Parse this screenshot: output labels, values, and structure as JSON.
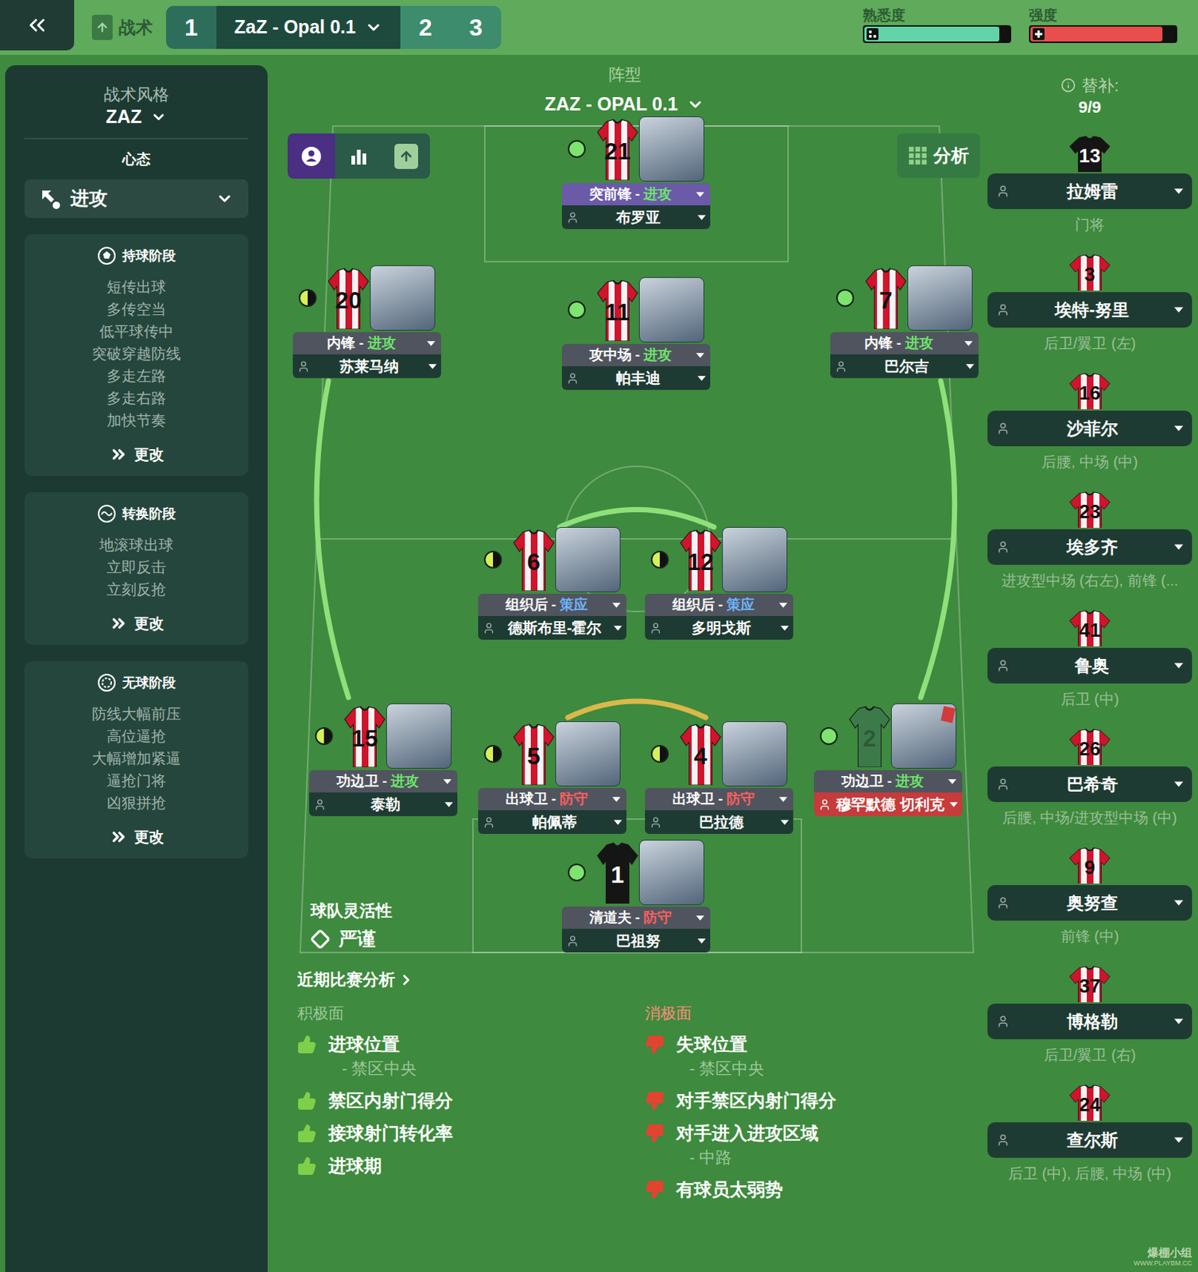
{
  "top_bar": {
    "tactics_tab": "战术",
    "tactic_slots": [
      {
        "label": "1",
        "selected": true,
        "name": "ZaZ - Opal 0.1"
      },
      {
        "label": "2",
        "selected": false,
        "name": ""
      },
      {
        "label": "3",
        "selected": false,
        "name": ""
      }
    ],
    "meters": [
      {
        "label": "熟悉度",
        "level": 0.93,
        "kind": "familiarity",
        "color": "#62d4a8"
      },
      {
        "label": "强度",
        "level": 0.91,
        "kind": "intensity",
        "color": "#e84e4c"
      }
    ]
  },
  "sidebar": {
    "style_label": "战术风格",
    "style_value": "ZAZ",
    "mentality_label": "心态",
    "mentality_value": "进攻",
    "change_label": "更改",
    "phases": [
      {
        "title": "持球阶段",
        "kind": "possession",
        "instructions": [
          "短传出球",
          "多传空当",
          "低平球传中",
          "突破穿越防线",
          "多走左路",
          "多走右路",
          "加快节奏"
        ]
      },
      {
        "title": "转换阶段",
        "kind": "transition",
        "instructions": [
          "地滚球出球",
          "立即反击",
          "立刻反抢"
        ]
      },
      {
        "title": "无球阶段",
        "kind": "defence",
        "instructions": [
          "防线大幅前压",
          "高位逼抢",
          "大幅增加紧逼",
          "逼抢门将",
          "凶狠拼抢"
        ]
      }
    ]
  },
  "pitch": {
    "formation_label": "阵型",
    "formation_name": "ZAZ - OPAL 0.1",
    "analysis_button": "分析",
    "view_buttons": [
      {
        "kind": "profile",
        "selected": true
      },
      {
        "kind": "stats",
        "selected": false
      },
      {
        "kind": "instructions",
        "selected": false
      }
    ],
    "role_separator": " - ",
    "flexibility_label": "球队灵活性",
    "flexibility_value": "严谨",
    "players": [
      {
        "number": "21",
        "role": "突前锋",
        "duty": "进攻",
        "duty_color": "#6de46a",
        "name": "布罗亚",
        "condition_level": 1,
        "shirt": "home",
        "selected": true,
        "warning": false
      },
      {
        "number": "20",
        "role": "内锋",
        "duty": "进攻",
        "duty_color": "#6de46a",
        "name": "苏莱马纳",
        "condition_level": 0.5,
        "shirt": "home",
        "selected": false,
        "warning": false
      },
      {
        "number": "11",
        "role": "攻中场",
        "duty": "进攻",
        "duty_color": "#6de46a",
        "name": "帕丰迪",
        "condition_level": 1,
        "shirt": "home",
        "selected": false,
        "warning": false
      },
      {
        "number": "7",
        "role": "内锋",
        "duty": "进攻",
        "duty_color": "#6de46a",
        "name": "巴尔吉",
        "condition_level": 1,
        "shirt": "home",
        "selected": false,
        "warning": false
      },
      {
        "number": "6",
        "role": "组织后",
        "duty": "策应",
        "duty_color": "#6cb6ff",
        "name": "德斯布里-霍尔",
        "condition_level": 0.5,
        "shirt": "home",
        "selected": false,
        "warning": false
      },
      {
        "number": "12",
        "role": "组织后",
        "duty": "策应",
        "duty_color": "#6cb6ff",
        "name": "多明戈斯",
        "condition_level": 0.5,
        "shirt": "home",
        "selected": false,
        "warning": false
      },
      {
        "number": "15",
        "role": "功边卫",
        "duty": "进攻",
        "duty_color": "#6de46a",
        "name": "泰勒",
        "condition_level": 0.5,
        "shirt": "home",
        "selected": false,
        "warning": false
      },
      {
        "number": "5",
        "role": "出球卫",
        "duty": "防守",
        "duty_color": "#ff5f5f",
        "name": "帕佩蒂",
        "condition_level": 0.5,
        "shirt": "home",
        "selected": false,
        "warning": false
      },
      {
        "number": "4",
        "role": "出球卫",
        "duty": "防守",
        "duty_color": "#ff5f5f",
        "name": "巴拉德",
        "condition_level": 0.5,
        "shirt": "home",
        "selected": false,
        "warning": false
      },
      {
        "number": "2",
        "role": "功边卫",
        "duty": "进攻",
        "duty_color": "#6de46a",
        "name": "穆罕默德 切利克",
        "condition_level": 1,
        "shirt": "faded",
        "selected": false,
        "warning": true
      },
      {
        "number": "1",
        "role": "清道夫",
        "duty": "防守",
        "duty_color": "#ff5f5f",
        "name": "巴祖努",
        "condition_level": 1,
        "shirt": "keeper",
        "selected": false,
        "warning": false
      }
    ]
  },
  "subs": {
    "label": "替补:",
    "count": "9/9",
    "players": [
      {
        "number": "13",
        "name": "拉姆雷",
        "position": "门将",
        "shirt": "keeper"
      },
      {
        "number": "3",
        "name": "埃特-努里",
        "position": "后卫/翼卫 (左)",
        "shirt": "home"
      },
      {
        "number": "16",
        "name": "沙菲尔",
        "position": "后腰, 中场 (中)",
        "shirt": "home"
      },
      {
        "number": "23",
        "name": "埃多齐",
        "position": "进攻型中场 (右左), 前锋 (...",
        "shirt": "home"
      },
      {
        "number": "41",
        "name": "鲁奥",
        "position": "后卫 (中)",
        "shirt": "home"
      },
      {
        "number": "26",
        "name": "巴希奇",
        "position": "后腰, 中场/进攻型中场 (中)",
        "shirt": "home"
      },
      {
        "number": "9",
        "name": "奥努查",
        "position": "前锋 (中)",
        "shirt": "home"
      },
      {
        "number": "37",
        "name": "博格勒",
        "position": "后卫/翼卫 (右)",
        "shirt": "home"
      },
      {
        "number": "24",
        "name": "查尔斯",
        "position": "后卫 (中), 后腰, 中场 (中)",
        "shirt": "home"
      }
    ]
  },
  "analysis": {
    "title": "近期比赛分析",
    "positive_label": "积极面",
    "negative_label": "消极面",
    "positives": [
      {
        "text": "进球位置",
        "detail": "- 禁区中央"
      },
      {
        "text": "禁区内射门得分",
        "detail": ""
      },
      {
        "text": "接球射门转化率",
        "detail": ""
      },
      {
        "text": "进球期",
        "detail": ""
      }
    ],
    "negatives": [
      {
        "text": "失球位置",
        "detail": "- 禁区中央"
      },
      {
        "text": "对手禁区内射门得分",
        "detail": ""
      },
      {
        "text": "对手进入进攻区域",
        "detail": "- 中路"
      },
      {
        "text": "有球员太弱势",
        "detail": ""
      }
    ]
  },
  "watermark": {
    "brand": "爆棚小组",
    "url": "WWW.PLAYBM.CC"
  }
}
